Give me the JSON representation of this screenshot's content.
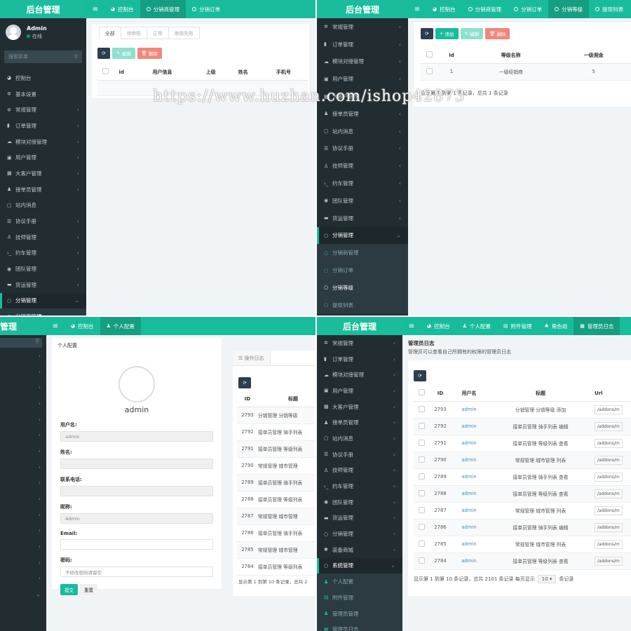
{
  "brand": "后台管理",
  "q1": {
    "user": {
      "name": "Admin",
      "status": "在线"
    },
    "search_placeholder": "搜索菜单",
    "tabs": [
      "控制台",
      "分销商管理",
      "分销订单"
    ],
    "menu": [
      {
        "label": "控制台",
        "icon": "dashboard-icon",
        "chev": false
      },
      {
        "label": "基本设置",
        "icon": "gear-icon",
        "chev": false
      },
      {
        "label": "常规管理",
        "icon": "cogs-icon",
        "chev": true
      },
      {
        "label": "订单管理",
        "icon": "book-icon",
        "chev": true
      },
      {
        "label": "模块对接管理",
        "icon": "cloud-icon",
        "chev": true
      },
      {
        "label": "用户管理",
        "icon": "user-card-icon",
        "chev": true
      },
      {
        "label": "大客户管理",
        "icon": "image-icon",
        "chev": true
      },
      {
        "label": "接单员管理",
        "icon": "user-icon",
        "chev": true
      },
      {
        "label": "站内消息",
        "icon": "message-icon",
        "chev": false
      },
      {
        "label": "协议手册",
        "icon": "list-icon",
        "chev": true
      },
      {
        "label": "技师管理",
        "icon": "child-icon",
        "chev": true
      },
      {
        "label": "约车管理",
        "icon": "terminal-icon",
        "chev": true
      },
      {
        "label": "团队管理",
        "icon": "eye-icon",
        "chev": true
      },
      {
        "label": "货运管理",
        "icon": "truck-icon",
        "chev": true
      },
      {
        "label": "分销管理",
        "icon": "circle-icon",
        "chev": true,
        "open": true
      }
    ],
    "submenu": [
      "分销商管理"
    ],
    "filters": [
      "全部",
      "待审核",
      "正常",
      "审核失败"
    ],
    "buttons": {
      "edit": "编辑",
      "del": "删除"
    },
    "columns": [
      "id",
      "用户信息",
      "上级",
      "姓名",
      "手机号"
    ]
  },
  "q2": {
    "tabs": [
      "控制台",
      "分销商管理",
      "分销订单",
      "分销等级",
      "提现列表"
    ],
    "menu": [
      "常规管理",
      "订单管理",
      "模块对接管理",
      "用户管理",
      "大客户管理",
      "接单员管理",
      "站内消息",
      "协议手册",
      "技师管理",
      "约车管理",
      "团队管理",
      "货运管理",
      "分销管理"
    ],
    "submenu": [
      "分销商管理",
      "分销订单",
      "分销等级",
      "提现列表"
    ],
    "buttons": {
      "add": "添加",
      "edit": "编辑",
      "del": "删除"
    },
    "columns": [
      "Id",
      "等级名称",
      "一级佣金"
    ],
    "rows": [
      {
        "id": "1",
        "name": "一级经销商",
        "commission": "5"
      }
    ],
    "footer": "显示第 1 到第 1 条记录，总共 1 条记录"
  },
  "q3": {
    "tabs": [
      "控制台",
      "个人配置"
    ],
    "panel_title": "个人配置",
    "username_display": "admin",
    "fields": [
      {
        "label": "用户名:",
        "value": "admin",
        "gray": true
      },
      {
        "label": "姓名:",
        "value": "",
        "gray": true
      },
      {
        "label": "联系电话:",
        "value": "",
        "gray": true
      },
      {
        "label": "昵称:",
        "value": "Admin",
        "gray": true
      },
      {
        "label": "Email:",
        "value": "",
        "gray": false
      },
      {
        "label": "密码:",
        "value": "不修改密码请留空",
        "gray": false
      }
    ],
    "submit": "提交",
    "reset": "重置",
    "log_tab": "操作日志",
    "log_columns": [
      "ID",
      "标题"
    ],
    "log_rows": [
      {
        "id": "2793",
        "title": "分销管理 分销等级"
      },
      {
        "id": "2792",
        "title": "接单员管理 骑手列表"
      },
      {
        "id": "2791",
        "title": "接单员管理 等级列表"
      },
      {
        "id": "2790",
        "title": "常规管理 城市管理"
      },
      {
        "id": "2789",
        "title": "接单员管理 骑手列表"
      },
      {
        "id": "2788",
        "title": "接单员管理 等级列表"
      },
      {
        "id": "2787",
        "title": "常规管理 城市管理"
      },
      {
        "id": "2786",
        "title": "接单员管理 骑手列表"
      },
      {
        "id": "2785",
        "title": "常规管理 城市管理"
      },
      {
        "id": "2784",
        "title": "接单员管理 等级列表"
      }
    ],
    "log_footer": "显示第 1 到第 10 条记录，总共 2"
  },
  "q4": {
    "tabs": [
      "控制台",
      "个人配置",
      "附件管理",
      "角色组",
      "管理员日志"
    ],
    "menu": [
      "常规管理",
      "订单管理",
      "模块对接管理",
      "用户管理",
      "大客户管理",
      "接单员管理",
      "站内消息",
      "协议手册",
      "技师管理",
      "约车管理",
      "团队管理",
      "货运管理",
      "分销管理",
      "装备商城",
      "系统管理"
    ],
    "submenu": [
      "个人配置",
      "附件管理",
      "管理员管理",
      "管理员日志"
    ],
    "page_title": "管理员日志",
    "page_desc": "管理员可以查看自己所拥有的权限的管理员日志",
    "columns": [
      "ID",
      "用户名",
      "标题",
      "Url"
    ],
    "rows": [
      {
        "id": "2793",
        "user": "admin",
        "title": "分销管理 分销等级 添加",
        "url": "/addons/m"
      },
      {
        "id": "2792",
        "user": "admin",
        "title": "接单员管理 骑手列表 编辑",
        "url": "/addons/m"
      },
      {
        "id": "2791",
        "user": "admin",
        "title": "接单员管理 等级列表 查看",
        "url": "/addons/m"
      },
      {
        "id": "2790",
        "user": "admin",
        "title": "常规管理 城市管理 列表",
        "url": "/addons/m"
      },
      {
        "id": "2789",
        "user": "admin",
        "title": "接单员管理 骑手列表 查看",
        "url": "/addons/m"
      },
      {
        "id": "2788",
        "user": "admin",
        "title": "接单员管理 等级列表 查看",
        "url": "/addons/m"
      },
      {
        "id": "2787",
        "user": "admin",
        "title": "常规管理 城市管理 列表",
        "url": "/addons/m"
      },
      {
        "id": "2786",
        "user": "admin",
        "title": "接单员管理 骑手列表 编辑",
        "url": "/addons/m"
      },
      {
        "id": "2785",
        "user": "admin",
        "title": "常规管理 城市管理 列表",
        "url": "/addons/m"
      },
      {
        "id": "2784",
        "user": "admin",
        "title": "接单员管理 等级列表 查看",
        "url": "/addons/m"
      }
    ],
    "footer_a": "显示第 1 到第 10 条记录，总共 2101 条记录 每页显示",
    "page_size": "10",
    "footer_b": "条记录"
  },
  "watermark": "https://www.huzhan.com/ishop42873"
}
